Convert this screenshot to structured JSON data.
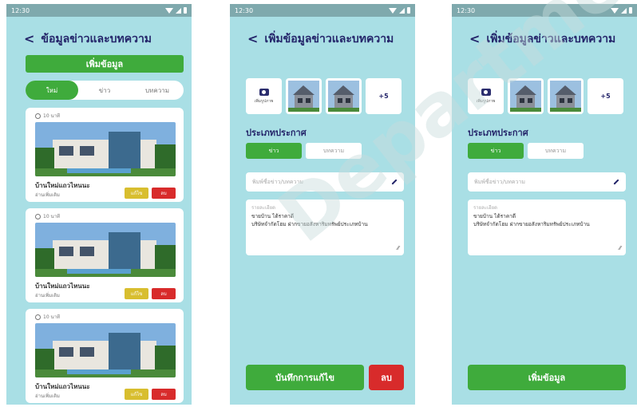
{
  "status_time": "12:30",
  "screen1": {
    "title": "ข้อมูลข่าวและบทความ",
    "add_button": "เพิ่มข้อมูล",
    "tabs": [
      "ใหม่",
      "ข่าว",
      "บทความ"
    ],
    "cards": [
      {
        "time": "10 นาที",
        "title": "บ้านใหม่แถวไหนนะ",
        "subtitle": "อ่านเพิ่มเติม",
        "edit": "แก้ไข",
        "delete": "ลบ"
      },
      {
        "time": "10 นาที",
        "title": "บ้านใหม่แถวไหนนะ",
        "subtitle": "อ่านเพิ่มเติม",
        "edit": "แก้ไข",
        "delete": "ลบ"
      },
      {
        "time": "10 นาที",
        "title": "บ้านใหม่แถวไหนนะ",
        "subtitle": "อ่านเพิ่มเติม",
        "edit": "แก้ไข",
        "delete": "ลบ"
      }
    ]
  },
  "screen2": {
    "title": "เพิ่มข้อมูลข่าวและบทความ",
    "upload_label": "เพิ่มรูปภาพ",
    "more_count": "+5",
    "section_title": "ประเภทประกาศ",
    "type_tabs": [
      "ข่าว",
      "บทความ"
    ],
    "name_placeholder": "พิมพ์ชื่อข่าว/บทความ",
    "detail_label": "รายละเอียด",
    "detail_line1": "ขายบ้าน ได้ราคาดี",
    "detail_line2": "บริษัทจำกัดโฮม ฝากขายอสังหาริมทรัพย์ประเภทบ้าน",
    "save_button": "บันทึกการแก้ไข",
    "delete_button": "ลบ"
  },
  "screen3": {
    "title": "เพิ่มข้อมูลข่าวและบทความ",
    "upload_label": "เพิ่มรูปภาพ",
    "more_count": "+5",
    "section_title": "ประเภทประกาศ",
    "type_tabs": [
      "ข่าว",
      "บทความ"
    ],
    "name_placeholder": "พิมพ์ชื่อข่าว/บทความ",
    "detail_label": "รายละเอียด",
    "detail_line1": "ขายบ้าน ได้ราคาดี",
    "detail_line2": "บริษัทจำกัดโฮม ฝากขายอสังหาริมทรัพย์ประเภทบ้าน",
    "add_button": "เพิ่มข้อมูล"
  },
  "colors": {
    "background": "#a9dfe5",
    "primary_green": "#3fab3c",
    "danger_red": "#d82b2b",
    "edit_yellow": "#d8be2f",
    "title_navy": "#24256a"
  },
  "watermark": "Department"
}
